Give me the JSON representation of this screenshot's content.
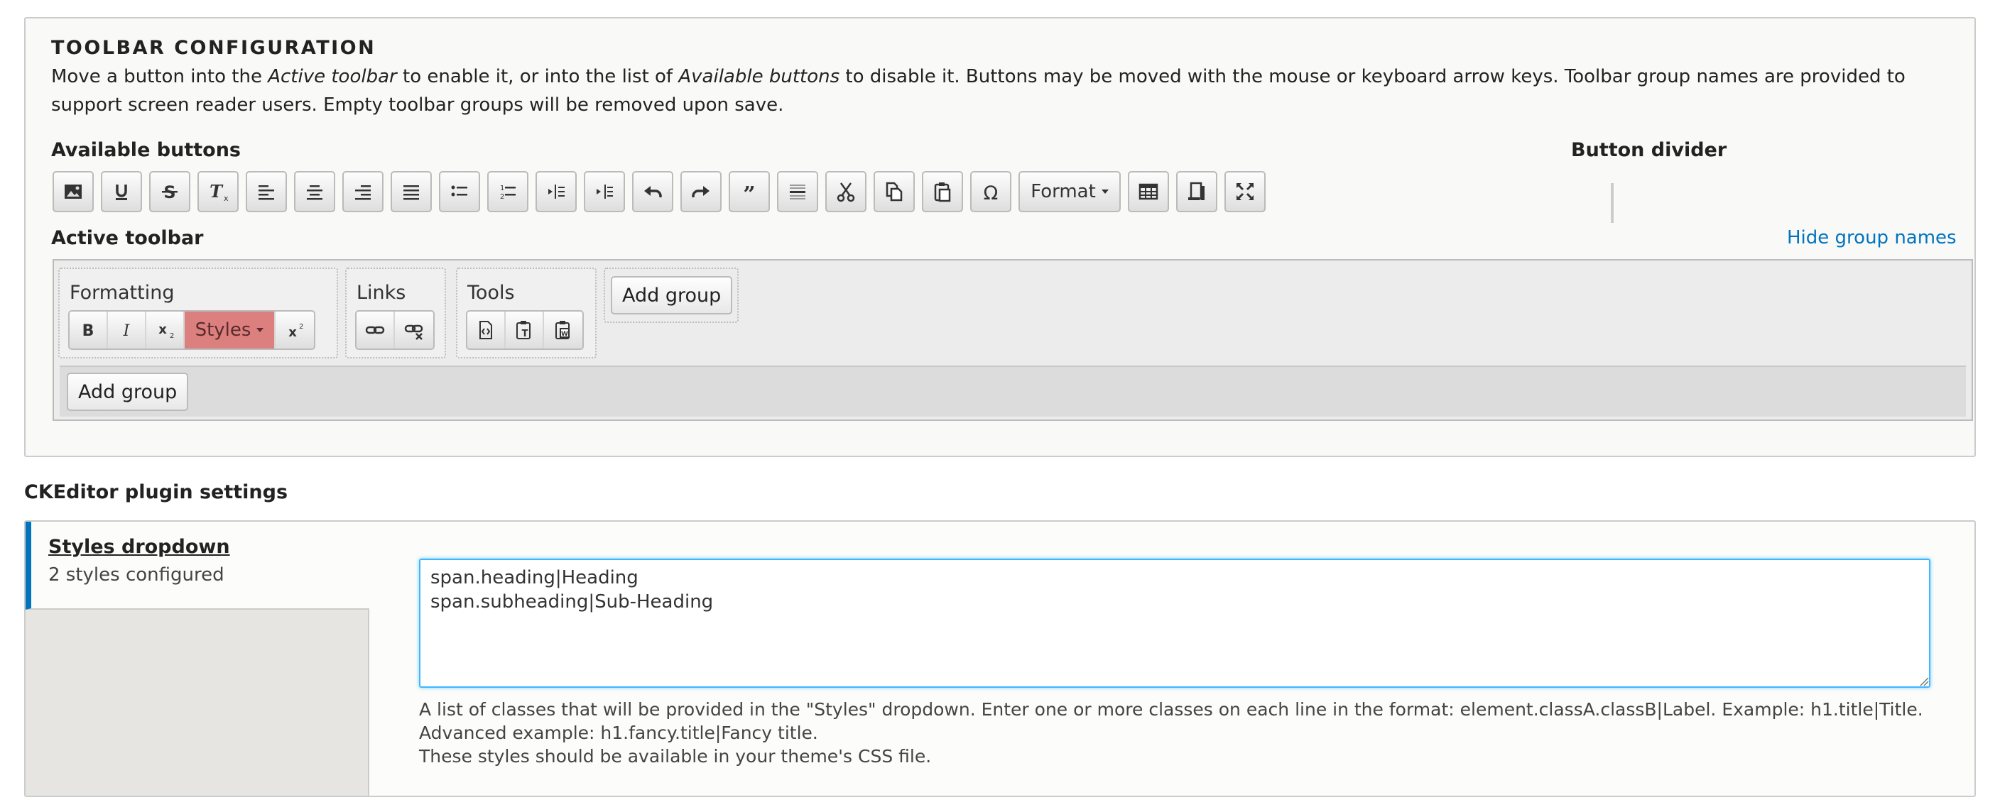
{
  "toolbar_config": {
    "legend": "TOOLBAR CONFIGURATION",
    "desc_1": "Move a button into the ",
    "desc_em1": "Active toolbar",
    "desc_2": " to enable it, or into the list of ",
    "desc_em2": "Available buttons",
    "desc_3": " to disable it. Buttons may be moved with the mouse or keyboard arrow keys. Toolbar group names are provided to support screen reader users. Empty toolbar groups will be removed upon save.",
    "available_label": "Available buttons",
    "divider_label": "Button divider",
    "active_label": "Active toolbar",
    "hide_group_names": "Hide group names",
    "available_buttons": [
      "image-icon",
      "underline-icon",
      "strikethrough-icon",
      "remove-format-icon",
      "align-left-icon",
      "align-center-icon",
      "align-right-icon",
      "align-justify-icon",
      "bulleted-list-icon",
      "numbered-list-icon",
      "outdent-icon",
      "indent-icon",
      "undo-icon",
      "redo-icon",
      "blockquote-icon",
      "horizontal-rule-icon",
      "cut-icon",
      "copy-icon",
      "paste-icon",
      "special-char-icon",
      "format-dropdown",
      "table-icon",
      "show-blocks-icon",
      "maximize-icon"
    ],
    "format_label": "Format",
    "groups": [
      {
        "name": "Formatting"
      },
      {
        "name": "Links"
      },
      {
        "name": "Tools"
      }
    ],
    "styles_label": "Styles",
    "add_group_label": "Add group"
  },
  "plugin_settings": {
    "title": "CKEditor plugin settings",
    "tab_title": "Styles dropdown",
    "tab_summary": "2 styles configured",
    "textarea_value": "span.heading|Heading\nspan.subheading|Sub-Heading",
    "help_1": "A list of classes that will be provided in the \"Styles\" dropdown. Enter one or more classes on each line in the format: element.classA.classB|Label. Example: h1.title|Title.",
    "help_2": "Advanced example: h1.fancy.title|Fancy title.",
    "help_3": "These styles should be available in your theme's CSS file."
  },
  "colors": {
    "accent": "#0074bd",
    "styles_highlight": "#dc7f7f",
    "focus": "#40b6ff"
  }
}
